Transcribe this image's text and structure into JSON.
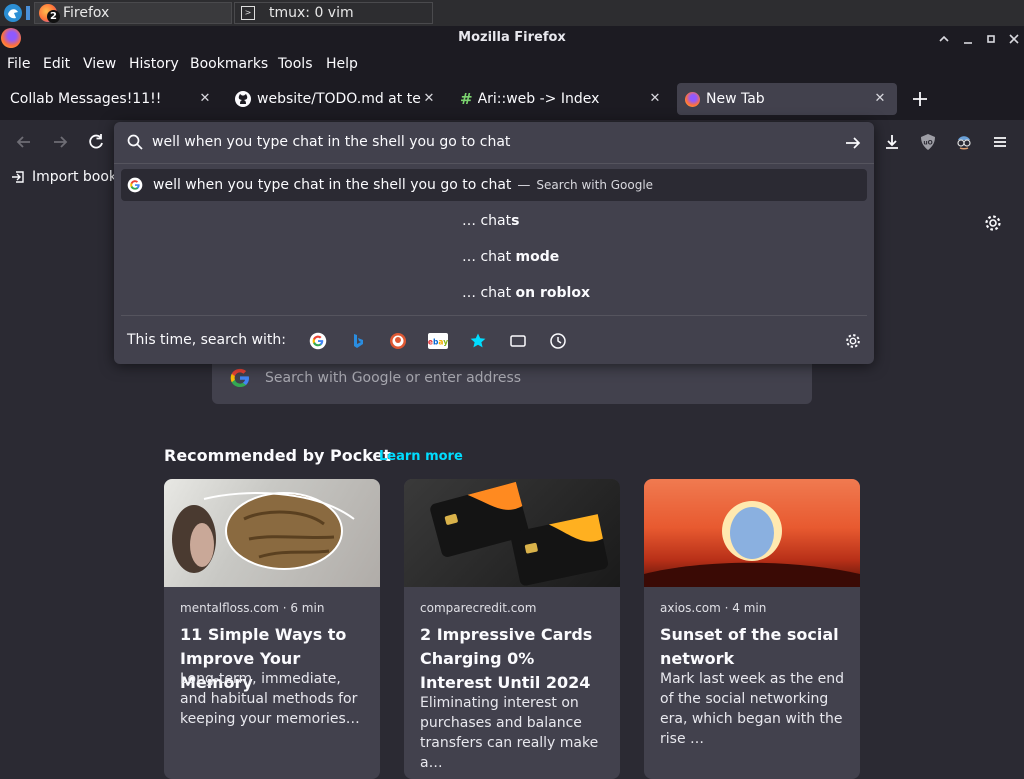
{
  "taskbar": {
    "apps": [
      {
        "label": "Firefox",
        "badge": "2"
      },
      {
        "label": "tmux: 0 vim"
      }
    ]
  },
  "window": {
    "title": "Mozilla Firefox"
  },
  "menubar": {
    "items": [
      "File",
      "Edit",
      "View",
      "History",
      "Bookmarks",
      "Tools",
      "Help"
    ]
  },
  "tabs": [
    {
      "label": "Collab Messages!11!!",
      "active": false
    },
    {
      "label": "website/TODO.md at ter",
      "active": false
    },
    {
      "label": "Ari::web -> Index",
      "active": false
    },
    {
      "label": "New Tab",
      "active": true
    }
  ],
  "urlbar": {
    "value": "well when you type chat in the shell you go to chat",
    "top_suggestion": {
      "text": "well when you type chat in the shell you go to chat",
      "dash": "—",
      "action": "Search with Google"
    },
    "suggestions": [
      {
        "prefix": "… chat",
        "bold": "s"
      },
      {
        "prefix": "… chat ",
        "bold": "mode"
      },
      {
        "prefix": "… chat ",
        "bold": "on roblox"
      }
    ],
    "search_with_label": "This time, search with:"
  },
  "bookmarks": {
    "import_label": "Import book"
  },
  "newtab": {
    "search_placeholder": "Search with Google or enter address",
    "pocket_heading": "Recommended by Pocket",
    "learn_more": "Learn more",
    "cards": [
      {
        "source": "mentalfloss.com · 6 min",
        "title": "11 Simple Ways to Improve Your Memory",
        "description": "Long-term, immediate, and habitual methods for keeping your memories…"
      },
      {
        "source": "comparecredit.com",
        "title": "2 Impressive Cards Charging 0% Interest Until 2024",
        "description": "Eliminating interest on purchases and balance transfers can really make a…"
      },
      {
        "source": "axios.com · 4 min",
        "title": "Sunset of the social network",
        "description": "Mark last week as the end of the social networking era, which began with the rise …"
      }
    ]
  },
  "colors": {
    "accent": "#00ddff",
    "background": "#2b2a33",
    "surface": "#42414d",
    "chrome": "#1c1b22"
  }
}
